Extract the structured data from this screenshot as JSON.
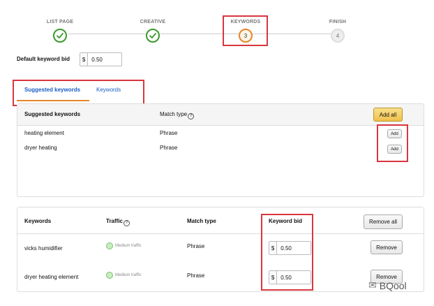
{
  "stepper": {
    "steps": [
      {
        "label": "LIST PAGE",
        "status": "done",
        "marker": "✓"
      },
      {
        "label": "CREATIVE",
        "status": "done",
        "marker": "✓"
      },
      {
        "label": "KEYWORDS",
        "status": "current",
        "marker": "3"
      },
      {
        "label": "FINISH",
        "status": "todo",
        "marker": "4"
      }
    ]
  },
  "default_bid": {
    "label": "Default keyword bid",
    "currency": "$",
    "value": "0.50"
  },
  "tabs": [
    {
      "label": "Suggested keywords",
      "active": true
    },
    {
      "label": "Keywords",
      "active": false
    }
  ],
  "suggested": {
    "header": {
      "keywords": "Suggested keywords",
      "match_type": "Match type",
      "help": "?"
    },
    "add_all_label": "Add all",
    "add_label": "Add",
    "rows": [
      {
        "keyword": "heating element",
        "match": "Phrase"
      },
      {
        "keyword": "dryer heating",
        "match": "Phrase"
      }
    ]
  },
  "keywords": {
    "header": {
      "keywords": "Keywords",
      "traffic": "Traffic",
      "match_type": "Match type",
      "bid": "Keyword bid",
      "help": "?"
    },
    "remove_all_label": "Remove all",
    "remove_label": "Remove",
    "currency": "$",
    "rows": [
      {
        "keyword": "vicks humidifier",
        "traffic": "Medium traffic",
        "match": "Phrase",
        "bid": "0.50"
      },
      {
        "keyword": "dryer heating element",
        "traffic": "Medium traffic",
        "match": "Phrase",
        "bid": "0.50"
      }
    ]
  },
  "watermark": {
    "text": "BQool"
  },
  "colors": {
    "accent_orange": "#e4862b",
    "check_green": "#3a9b2c",
    "link_blue": "#1a5ec3",
    "highlight_red": "#d9363e",
    "button_yellow": "#f0c14b"
  }
}
